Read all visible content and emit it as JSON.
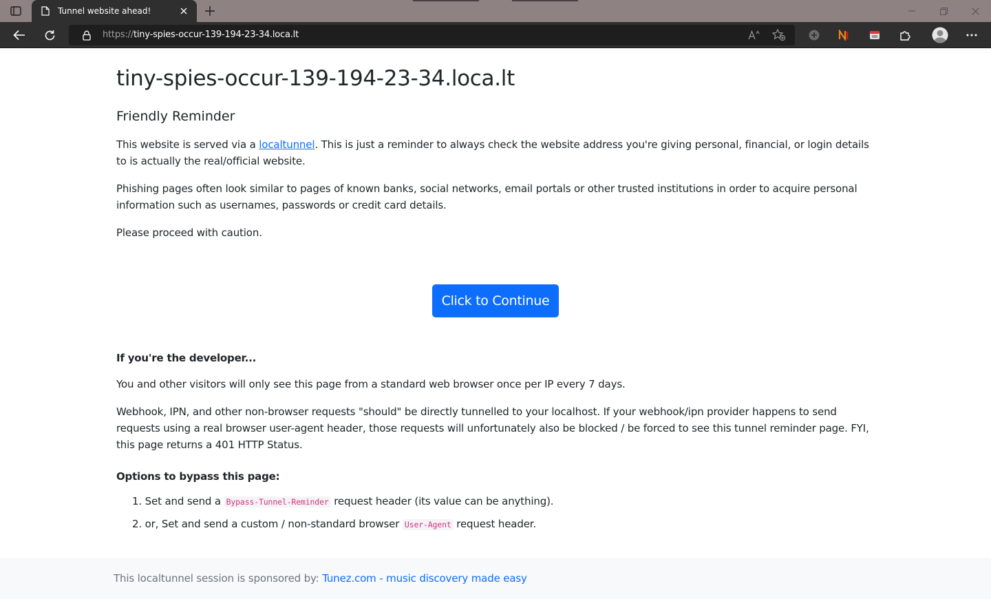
{
  "browser": {
    "tab": {
      "title": "Tunnel website ahead!"
    },
    "address": {
      "protocol": "https://",
      "host": "tiny-spies-occur-139-194-23-34.loca.lt"
    }
  },
  "page": {
    "heading": "tiny-spies-occur-139-194-23-34.loca.lt",
    "subheading": "Friendly Reminder",
    "para1_before": "This website is served via a ",
    "para1_link": "localtunnel",
    "para1_after": ". This is just a reminder to always check the website address you're giving personal, financial, or login details to is actually the real/official website.",
    "para2": "Phishing pages often look similar to pages of known banks, social networks, email portals or other trusted institutions in order to acquire personal information such as usernames, passwords or credit card details.",
    "para3": "Please proceed with caution.",
    "continue_button": "Click to Continue",
    "developer_heading": "If you're the developer...",
    "developer_para1": "You and other visitors will only see this page from a standard web browser once per IP every 7 days.",
    "developer_para2": "Webhook, IPN, and other non-browser requests \"should\" be directly tunnelled to your localhost. If your webhook/ipn provider happens to send requests using a real browser user-agent header, those requests will unfortunately also be blocked / be forced to see this tunnel reminder page. FYI, this page returns a 401 HTTP Status.",
    "options_heading": "Options to bypass this page:",
    "options": [
      {
        "num": "1.",
        "before": "Set and send a ",
        "code": "Bypass-Tunnel-Reminder",
        "after": " request header (its value can be anything)."
      },
      {
        "num": "2.",
        "before": "or, Set and send a custom / non-standard browser ",
        "code": "User-Agent",
        "after": " request header."
      }
    ]
  },
  "footer": {
    "text": "This localtunnel session is sponsored by: ",
    "link": "Tunez.com - music discovery made easy"
  },
  "colors": {
    "primary": "#0d6efd",
    "code": "#d63384",
    "chrome_dark": "#2f2f2f",
    "tabstrip": "#8e8283"
  }
}
